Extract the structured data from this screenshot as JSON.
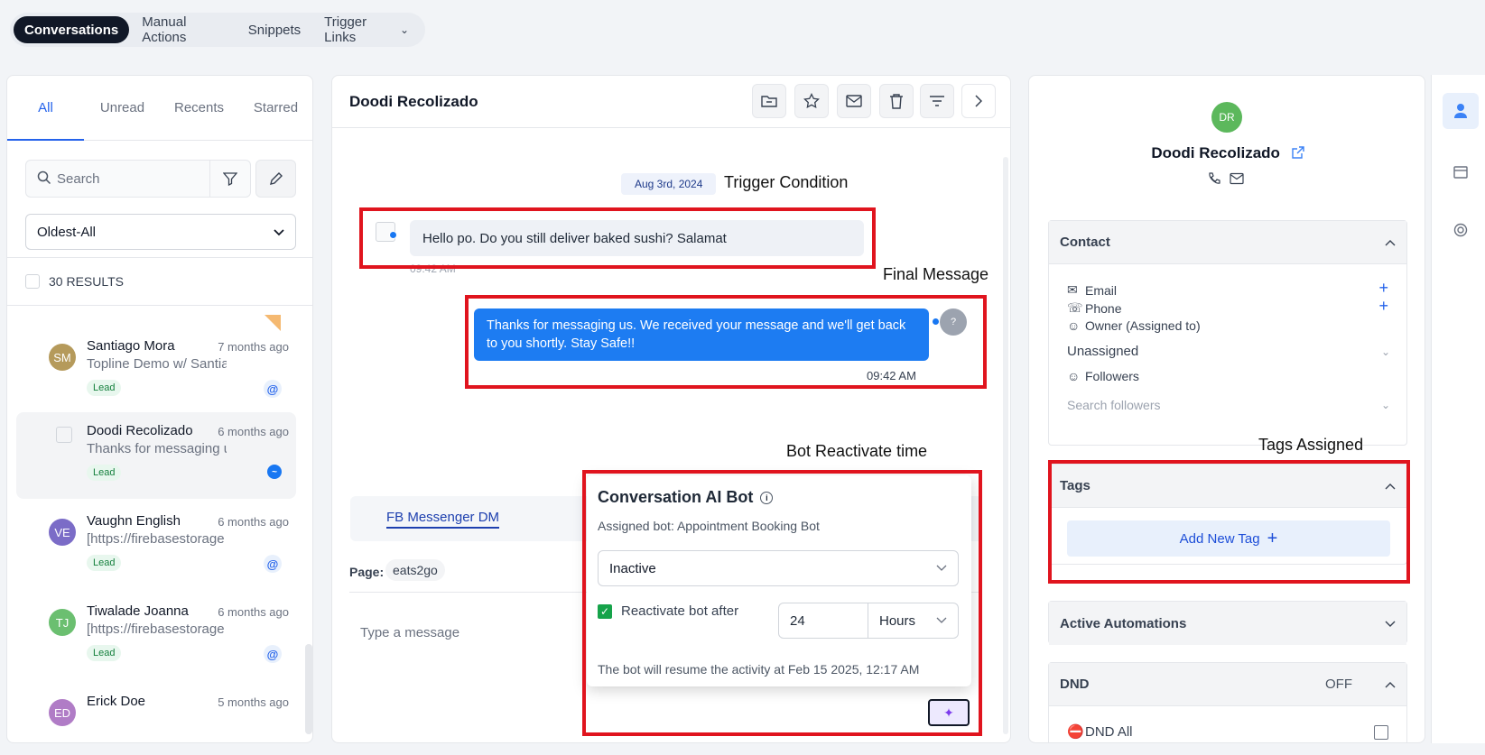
{
  "top_tabs": [
    {
      "label": "Conversations"
    },
    {
      "label": "Manual Actions"
    },
    {
      "label": "Snippets"
    },
    {
      "label": "Trigger Links"
    }
  ],
  "left": {
    "tabs": [
      "All",
      "Unread",
      "Recents",
      "Starred"
    ],
    "search_placeholder": "Search",
    "sort_value": "Oldest-All",
    "results": "30 RESULTS",
    "conversations": [
      {
        "initials": "SM",
        "name": "Santiago Mora",
        "time": "7 months ago",
        "preview": "Topline Demo w/ Santiago",
        "badge": "Lead",
        "avatar_color": "#b59a5b",
        "channel": "email"
      },
      {
        "initials": "",
        "name": "Doodi Recolizado",
        "time": "6 months ago",
        "preview": "Thanks for messaging us",
        "badge": "Lead",
        "avatar_color": "#ffffff",
        "channel": "messenger"
      },
      {
        "initials": "VE",
        "name": "Vaughn English",
        "time": "6 months ago",
        "preview": "[https://firebasestorage",
        "badge": "Lead",
        "avatar_color": "#7b6cc7",
        "channel": "email"
      },
      {
        "initials": "TJ",
        "name": "Tiwalade Joanna",
        "time": "6 months ago",
        "preview": "[https://firebasestorage",
        "badge": "Lead",
        "avatar_color": "#6bbf70",
        "channel": "email"
      },
      {
        "initials": "ED",
        "name": "Erick Doe",
        "time": "5 months ago",
        "preview": "",
        "badge": "",
        "avatar_color": "#b07cc6",
        "channel": ""
      }
    ]
  },
  "mid": {
    "contact_name": "Doodi Recolizado",
    "date_pill": "Aug 3rd, 2024",
    "incoming_message": "Hello po. Do you still deliver baked sushi? Salamat",
    "incoming_time": "09:42 AM",
    "outgoing_message": "Thanks for messaging us. We received your message and we'll get back to you shortly. Stay Safe!!",
    "outgoing_time": "09:42 AM",
    "outgoing_avatar": "?",
    "channel_tab": "FB Messenger DM",
    "page_label": "Page:",
    "page_value": "eats2go",
    "composer_placeholder": "Type a message"
  },
  "bot_popup": {
    "title": "Conversation AI Bot",
    "assigned": "Assigned bot: Appointment Booking Bot",
    "status": "Inactive",
    "reactivate_label": "Reactivate bot after",
    "reactivate_value": "24",
    "reactivate_unit": "Hours",
    "footer": "The bot will resume the activity at Feb 15 2025, 12:17 AM"
  },
  "annotations": {
    "trigger": "Trigger Condition",
    "final": "Final Message",
    "bot_time": "Bot Reactivate time",
    "tags": "Tags Assigned"
  },
  "right": {
    "initials": "DR",
    "name": "Doodi Recolizado",
    "contact_section": "Contact",
    "email_label": "Email",
    "phone_label": "Phone",
    "owner_label": "Owner (Assigned to)",
    "owner_value": "Unassigned",
    "followers_label": "Followers",
    "followers_placeholder": "Search followers",
    "tags_section": "Tags",
    "add_tag": "Add New Tag",
    "automations_section": "Active Automations",
    "dnd_section": "DND",
    "dnd_status": "OFF",
    "dnd_all": "DND All"
  },
  "colors": {
    "accent": "#2563eb",
    "annotation_red": "#e0141e",
    "outgoing_bubble": "#1d7cf2"
  }
}
